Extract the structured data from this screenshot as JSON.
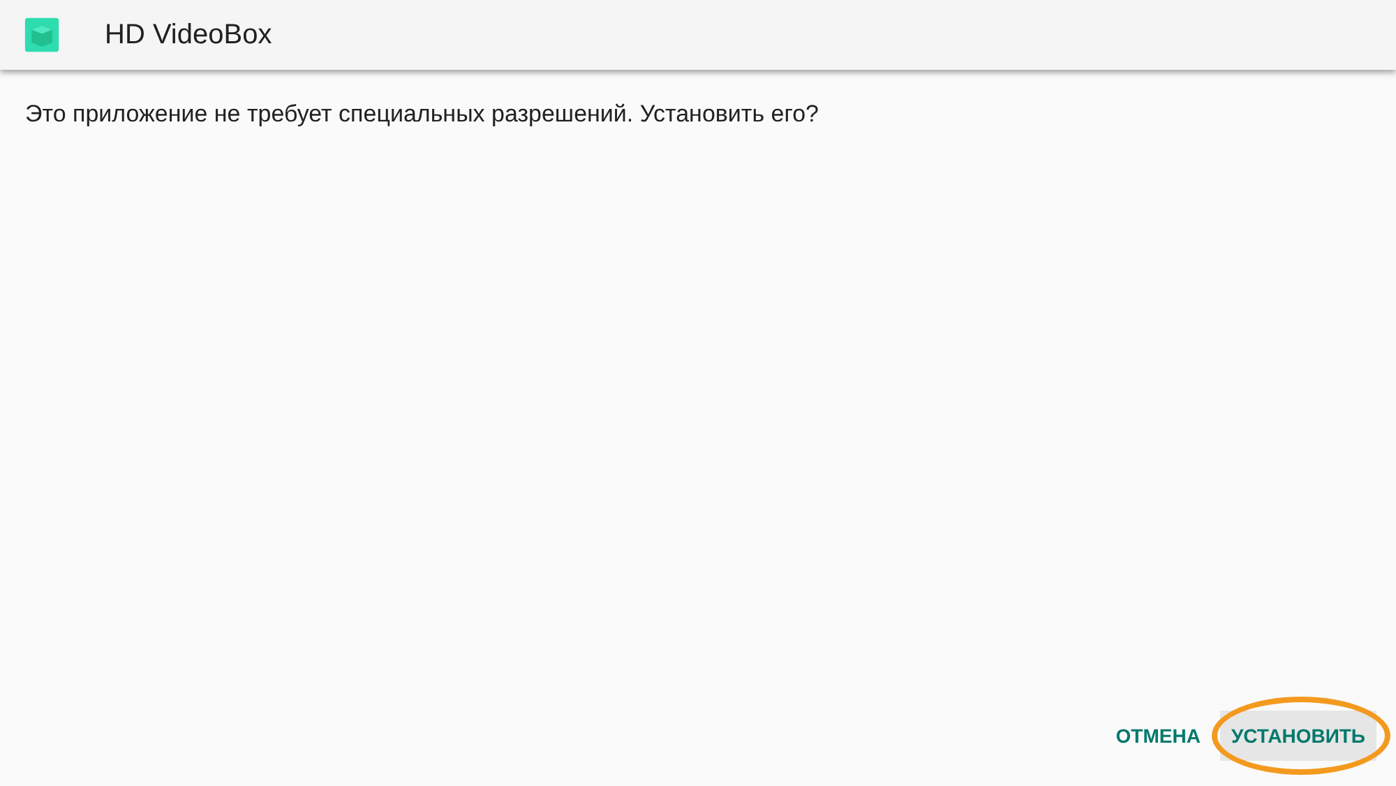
{
  "app_bar": {
    "title": "HD VideoBox"
  },
  "message": "Это приложение не требует специальных разрешений. Установить его?",
  "buttons": [
    {
      "label": "ОТМЕНА",
      "focused": false,
      "circled": false
    },
    {
      "label": "УСТАНОВИТЬ",
      "focused": true,
      "circled": true
    }
  ]
}
